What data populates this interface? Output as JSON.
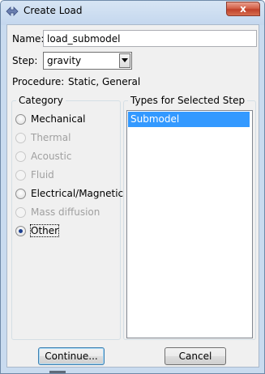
{
  "window": {
    "title": "Create Load",
    "close_glyph": "x"
  },
  "form": {
    "name_label": "Name:",
    "name_value": "load_submodel",
    "step_label": "Step:",
    "step_value": "gravity",
    "procedure_label": "Procedure:",
    "procedure_value": "Static, General"
  },
  "category": {
    "title": "Category",
    "options": [
      {
        "label": "Mechanical",
        "enabled": true,
        "selected": false
      },
      {
        "label": "Thermal",
        "enabled": false,
        "selected": false
      },
      {
        "label": "Acoustic",
        "enabled": false,
        "selected": false
      },
      {
        "label": "Fluid",
        "enabled": false,
        "selected": false
      },
      {
        "label": "Electrical/Magnetic",
        "enabled": true,
        "selected": false
      },
      {
        "label": "Mass diffusion",
        "enabled": false,
        "selected": false
      },
      {
        "label": "Other",
        "enabled": true,
        "selected": true
      }
    ]
  },
  "types": {
    "title": "Types for Selected Step",
    "items": [
      "Submodel"
    ],
    "selected_item": "Submodel"
  },
  "buttons": {
    "continue": "Continue...",
    "cancel": "Cancel"
  },
  "colors": {
    "selection": "#3399ff",
    "close_button": "#c0412a",
    "title_bar": "#c4d7ee"
  },
  "icons": {
    "app": "abaqus-app-icon",
    "close": "close-icon",
    "dropdown": "chevron-down-icon"
  }
}
